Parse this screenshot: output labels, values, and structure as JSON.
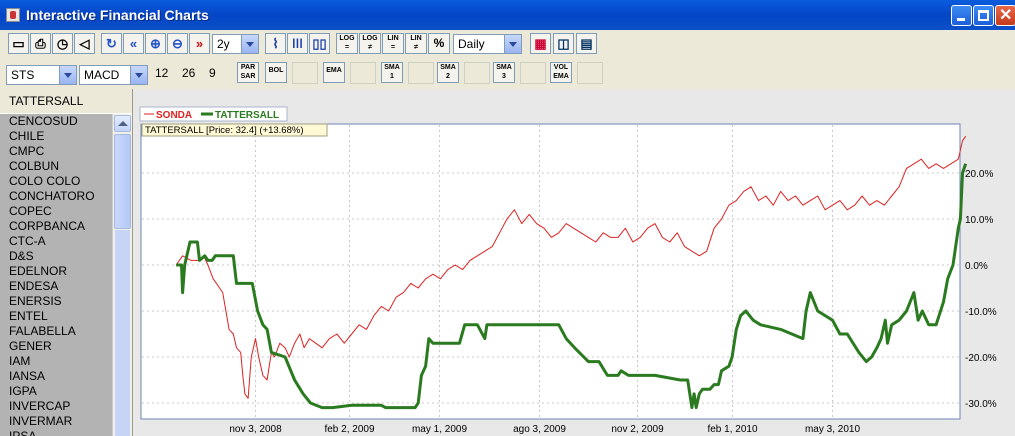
{
  "window": {
    "title": "Interactive Financial Charts"
  },
  "toolbar1": {
    "icons": [
      "print-screen-icon",
      "print-icon",
      "timer-icon",
      "sound-icon",
      "refresh-icon",
      "rewind-icon",
      "zoom-in-icon",
      "zoom-out-icon",
      "fast-forward-icon"
    ],
    "period": {
      "value": "2y"
    },
    "chart_types": [
      "line-chart-icon",
      "bar-chart-icon",
      "candlestick-icon"
    ],
    "scales": [
      {
        "top": "LOG",
        "bottom": "="
      },
      {
        "top": "LOG",
        "bottom": "≠"
      },
      {
        "top": "LIN",
        "bottom": "="
      },
      {
        "top": "LIN",
        "bottom": "≠"
      },
      {
        "top": "%",
        "bottom": ""
      }
    ],
    "interval": {
      "value": "Daily"
    },
    "right_icons": [
      "color-palette-icon",
      "chart-window-icon",
      "data-table-icon"
    ]
  },
  "toolbar2": {
    "indicator1": {
      "value": "STS"
    },
    "indicator2": {
      "value": "MACD"
    },
    "params": [
      "12",
      "26",
      "9"
    ],
    "buttons": [
      {
        "name": "par-sar-button",
        "top": "PAR",
        "bottom": "SAR"
      },
      {
        "name": "bol-button",
        "top": "BOL",
        "bottom": ""
      },
      {
        "name": "ema-button",
        "top": "EMA",
        "bottom": ""
      },
      {
        "name": "sma-button-1",
        "top": "SMA",
        "bottom": "1"
      },
      {
        "name": "sma-button-2",
        "top": "SMA",
        "bottom": "2"
      },
      {
        "name": "sma-button-3",
        "top": "SMA",
        "bottom": "3"
      },
      {
        "name": "vol-ema-button",
        "top": "VOL",
        "bottom": "EMA"
      }
    ]
  },
  "sidebar": {
    "header": "TATTERSALL",
    "items": [
      "CENCOSUD",
      "CHILE",
      "CMPC",
      "COLBUN",
      "COLO COLO",
      "CONCHATORO",
      "COPEC",
      "CORPBANCA",
      "CTC-A",
      "D&S",
      "EDELNOR",
      "ENDESA",
      "ENERSIS",
      "ENTEL",
      "FALABELLA",
      "GENER",
      "IAM",
      "IANSA",
      "IGPA",
      "INVERCAP",
      "INVERMAR",
      "IPSA"
    ]
  },
  "chart_data": {
    "type": "line",
    "tooltip": "TATTERSALL [Price: 32.4] (+13.68%)",
    "legend_position": "top-left",
    "x_ticks": [
      "nov 3, 2008",
      "feb 2, 2009",
      "may 1, 2009",
      "ago 3, 2009",
      "nov 2, 2009",
      "feb 1, 2010",
      "may 3, 2010"
    ],
    "y_ticks": [
      "20.0%",
      "10.0%",
      "0.0%",
      "-10.0%",
      "-20.0%",
      "-30.0%"
    ],
    "ylim": [
      -32,
      28
    ],
    "grid": true,
    "series": [
      {
        "name": "SONDA",
        "color": "#DD2222",
        "points": [
          [
            "2008-08-20",
            0
          ],
          [
            "2008-08-26",
            2
          ],
          [
            "2008-09-03",
            1
          ],
          [
            "2008-09-10",
            1
          ],
          [
            "2008-09-15",
            2
          ],
          [
            "2008-09-19",
            0
          ],
          [
            "2008-09-24",
            -3
          ],
          [
            "2008-09-30",
            -5
          ],
          [
            "2008-10-03",
            -6
          ],
          [
            "2008-10-06",
            -10
          ],
          [
            "2008-10-09",
            -14
          ],
          [
            "2008-10-13",
            -15
          ],
          [
            "2008-10-16",
            -18
          ],
          [
            "2008-10-20",
            -19
          ],
          [
            "2008-10-22",
            -24
          ],
          [
            "2008-10-24",
            -28
          ],
          [
            "2008-10-27",
            -29
          ],
          [
            "2008-10-30",
            -20
          ],
          [
            "2008-11-03",
            -16
          ],
          [
            "2008-11-06",
            -20
          ],
          [
            "2008-11-10",
            -24
          ],
          [
            "2008-11-14",
            -25
          ],
          [
            "2008-11-18",
            -19
          ],
          [
            "2008-11-21",
            -20
          ],
          [
            "2008-11-26",
            -17
          ],
          [
            "2008-12-01",
            -18
          ],
          [
            "2008-12-05",
            -20
          ],
          [
            "2008-12-10",
            -17
          ],
          [
            "2008-12-15",
            -15
          ],
          [
            "2008-12-19",
            -18
          ],
          [
            "2008-12-24",
            -16
          ],
          [
            "2008-12-30",
            -17
          ],
          [
            "2009-01-05",
            -18
          ],
          [
            "2009-01-12",
            -16
          ],
          [
            "2009-01-19",
            -15
          ],
          [
            "2009-01-26",
            -17
          ],
          [
            "2009-02-02",
            -15
          ],
          [
            "2009-02-09",
            -13
          ],
          [
            "2009-02-16",
            -14
          ],
          [
            "2009-02-23",
            -11
          ],
          [
            "2009-03-02",
            -9
          ],
          [
            "2009-03-09",
            -10
          ],
          [
            "2009-03-16",
            -7
          ],
          [
            "2009-03-23",
            -6
          ],
          [
            "2009-03-30",
            -4
          ],
          [
            "2009-04-06",
            -5
          ],
          [
            "2009-04-13",
            -3
          ],
          [
            "2009-04-20",
            -2
          ],
          [
            "2009-04-27",
            -3
          ],
          [
            "2009-05-04",
            -1
          ],
          [
            "2009-05-11",
            0
          ],
          [
            "2009-05-18",
            -1
          ],
          [
            "2009-05-25",
            1
          ],
          [
            "2009-06-01",
            2
          ],
          [
            "2009-06-08",
            3
          ],
          [
            "2009-06-15",
            4
          ],
          [
            "2009-06-22",
            7
          ],
          [
            "2009-06-29",
            10
          ],
          [
            "2009-07-06",
            12
          ],
          [
            "2009-07-13",
            9
          ],
          [
            "2009-07-20",
            11
          ],
          [
            "2009-07-27",
            9
          ],
          [
            "2009-08-03",
            8
          ],
          [
            "2009-08-10",
            6
          ],
          [
            "2009-08-17",
            7
          ],
          [
            "2009-08-24",
            9
          ],
          [
            "2009-08-31",
            8
          ],
          [
            "2009-09-07",
            7
          ],
          [
            "2009-09-14",
            6
          ],
          [
            "2009-09-21",
            5
          ],
          [
            "2009-09-28",
            7
          ],
          [
            "2009-10-05",
            6
          ],
          [
            "2009-10-12",
            6
          ],
          [
            "2009-10-19",
            8
          ],
          [
            "2009-10-26",
            5
          ],
          [
            "2009-11-02",
            6
          ],
          [
            "2009-11-09",
            8
          ],
          [
            "2009-11-16",
            9
          ],
          [
            "2009-11-23",
            6
          ],
          [
            "2009-11-30",
            5
          ],
          [
            "2009-12-07",
            7
          ],
          [
            "2009-12-14",
            4
          ],
          [
            "2009-12-21",
            3
          ],
          [
            "2009-12-28",
            2
          ],
          [
            "2010-01-04",
            3
          ],
          [
            "2010-01-11",
            8
          ],
          [
            "2010-01-18",
            10
          ],
          [
            "2010-01-25",
            13
          ],
          [
            "2010-02-01",
            14
          ],
          [
            "2010-02-08",
            16
          ],
          [
            "2010-02-15",
            17
          ],
          [
            "2010-02-22",
            14
          ],
          [
            "2010-03-01",
            15
          ],
          [
            "2010-03-08",
            13
          ],
          [
            "2010-03-15",
            16
          ],
          [
            "2010-03-22",
            14
          ],
          [
            "2010-03-29",
            15
          ],
          [
            "2010-04-05",
            13
          ],
          [
            "2010-04-12",
            14
          ],
          [
            "2010-04-19",
            15
          ],
          [
            "2010-04-26",
            12
          ],
          [
            "2010-05-03",
            13
          ],
          [
            "2010-05-10",
            14
          ],
          [
            "2010-05-17",
            12
          ],
          [
            "2010-05-24",
            13
          ],
          [
            "2010-05-31",
            15
          ],
          [
            "2010-06-07",
            13
          ],
          [
            "2010-06-14",
            14
          ],
          [
            "2010-06-21",
            13
          ],
          [
            "2010-06-28",
            15
          ],
          [
            "2010-07-05",
            17
          ],
          [
            "2010-07-12",
            21
          ],
          [
            "2010-07-19",
            22
          ],
          [
            "2010-07-26",
            23
          ],
          [
            "2010-08-02",
            21
          ],
          [
            "2010-08-09",
            22
          ],
          [
            "2010-08-16",
            21
          ],
          [
            "2010-08-23",
            22
          ],
          [
            "2010-08-30",
            23
          ],
          [
            "2010-09-03",
            27
          ],
          [
            "2010-09-06",
            28
          ]
        ]
      },
      {
        "name": "TATTERSALL",
        "color": "#2A7A1F",
        "points": [
          [
            "2008-08-20",
            0
          ],
          [
            "2008-08-25",
            0
          ],
          [
            "2008-08-26",
            -6
          ],
          [
            "2008-08-28",
            0
          ],
          [
            "2008-09-02",
            5
          ],
          [
            "2008-09-09",
            5
          ],
          [
            "2008-09-11",
            1
          ],
          [
            "2008-09-16",
            2
          ],
          [
            "2008-09-19",
            1
          ],
          [
            "2008-09-23",
            1
          ],
          [
            "2008-09-26",
            2
          ],
          [
            "2008-10-03",
            2
          ],
          [
            "2008-10-13",
            2
          ],
          [
            "2008-10-16",
            -4
          ],
          [
            "2008-10-24",
            -4
          ],
          [
            "2008-10-31",
            -4
          ],
          [
            "2008-11-05",
            -10
          ],
          [
            "2008-11-10",
            -13
          ],
          [
            "2008-11-14",
            -14
          ],
          [
            "2008-11-18",
            -19
          ],
          [
            "2008-12-01",
            -20
          ],
          [
            "2008-12-10",
            -25
          ],
          [
            "2008-12-18",
            -28
          ],
          [
            "2008-12-25",
            -30
          ],
          [
            "2009-01-05",
            -31
          ],
          [
            "2009-01-15",
            -31
          ],
          [
            "2009-02-02",
            -30.5
          ],
          [
            "2009-03-02",
            -30.5
          ],
          [
            "2009-03-06",
            -31
          ],
          [
            "2009-04-03",
            -31
          ],
          [
            "2009-04-06",
            -30
          ],
          [
            "2009-04-09",
            -24
          ],
          [
            "2009-04-13",
            -22
          ],
          [
            "2009-04-16",
            -16
          ],
          [
            "2009-04-20",
            -17
          ],
          [
            "2009-05-01",
            -17
          ],
          [
            "2009-05-15",
            -17
          ],
          [
            "2009-05-20",
            -13
          ],
          [
            "2009-06-01",
            -13
          ],
          [
            "2009-06-08",
            -16
          ],
          [
            "2009-06-10",
            -13
          ],
          [
            "2009-06-30",
            -13
          ],
          [
            "2009-07-30",
            -13
          ],
          [
            "2009-08-17",
            -13
          ],
          [
            "2009-08-24",
            -16
          ],
          [
            "2009-09-01",
            -18
          ],
          [
            "2009-09-14",
            -21
          ],
          [
            "2009-09-24",
            -21
          ],
          [
            "2009-10-02",
            -24
          ],
          [
            "2009-10-12",
            -24
          ],
          [
            "2009-10-15",
            -23
          ],
          [
            "2009-10-22",
            -24
          ],
          [
            "2009-11-02",
            -24
          ],
          [
            "2009-11-16",
            -24
          ],
          [
            "2009-12-10",
            -25
          ],
          [
            "2009-12-17",
            -25
          ],
          [
            "2009-12-21",
            -31
          ],
          [
            "2009-12-23",
            -28
          ],
          [
            "2009-12-25",
            -31
          ],
          [
            "2009-12-28",
            -28
          ],
          [
            "2009-12-31",
            -27
          ],
          [
            "2010-01-07",
            -27
          ],
          [
            "2010-01-11",
            -26
          ],
          [
            "2010-01-15",
            -26
          ],
          [
            "2010-01-18",
            -23
          ],
          [
            "2010-01-25",
            -22
          ],
          [
            "2010-01-28",
            -20
          ],
          [
            "2010-02-01",
            -14
          ],
          [
            "2010-02-05",
            -11
          ],
          [
            "2010-02-10",
            -10
          ],
          [
            "2010-02-17",
            -12
          ],
          [
            "2010-02-24",
            -13
          ],
          [
            "2010-03-15",
            -14
          ],
          [
            "2010-04-05",
            -16
          ],
          [
            "2010-04-08",
            -10
          ],
          [
            "2010-04-12",
            -6
          ],
          [
            "2010-04-19",
            -10
          ],
          [
            "2010-05-03",
            -12
          ],
          [
            "2010-05-10",
            -15
          ],
          [
            "2010-05-17",
            -15
          ],
          [
            "2010-05-28",
            -19
          ],
          [
            "2010-06-04",
            -21
          ],
          [
            "2010-06-09",
            -20
          ],
          [
            "2010-06-14",
            -18
          ],
          [
            "2010-06-18",
            -16
          ],
          [
            "2010-06-22",
            -12
          ],
          [
            "2010-06-24",
            -17
          ],
          [
            "2010-06-28",
            -13
          ],
          [
            "2010-07-05",
            -12
          ],
          [
            "2010-07-12",
            -10
          ],
          [
            "2010-07-19",
            -6
          ],
          [
            "2010-07-23",
            -12
          ],
          [
            "2010-07-27",
            -10
          ],
          [
            "2010-08-02",
            -13
          ],
          [
            "2010-08-09",
            -13
          ],
          [
            "2010-08-16",
            -8
          ],
          [
            "2010-08-20",
            -3
          ],
          [
            "2010-08-25",
            0
          ],
          [
            "2010-08-30",
            8
          ],
          [
            "2010-09-01",
            10
          ],
          [
            "2010-09-03",
            20
          ],
          [
            "2010-09-06",
            22
          ]
        ]
      }
    ]
  }
}
